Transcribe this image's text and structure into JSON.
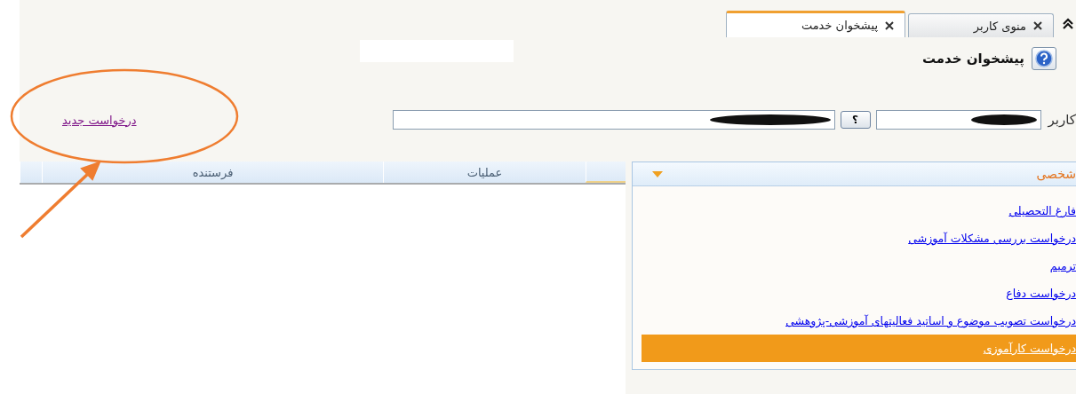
{
  "tabs": [
    {
      "label": "منوی کاربر",
      "selected": false
    },
    {
      "label": "پیشخوان خدمت",
      "selected": true
    }
  ],
  "page_title": "پیشخوان خدمت",
  "user_label": "کاربر",
  "lookup_button": "؟",
  "new_request_link": "درخواست جدید",
  "grid": {
    "columns": [
      "عملیات",
      "فرستنده"
    ]
  },
  "services": {
    "title": "شخصی",
    "items": [
      {
        "label": "فارغ التحصیلی",
        "selected": false
      },
      {
        "label": "درخواست بررسی مشکلات آموزشی",
        "selected": false
      },
      {
        "label": "ترمیم",
        "selected": false
      },
      {
        "label": "درخواست دفاع",
        "selected": false
      },
      {
        "label": "درخواست تصویب موضوع و اساتید فعالیتهای آموزشی-پژوهشی",
        "selected": false
      },
      {
        "label": "درخواست کارآموزی",
        "selected": true
      }
    ]
  }
}
